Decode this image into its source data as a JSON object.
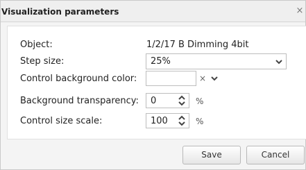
{
  "dialog": {
    "title": "Visualization parameters",
    "close_glyph": "×"
  },
  "fields": {
    "object": {
      "label": "Object:",
      "value": "1/2/17 B Dimming 4bit"
    },
    "step_size": {
      "label": "Step size:",
      "selected": "25%"
    },
    "background_color": {
      "label": "Control background color:",
      "value": "",
      "clear_glyph": "×"
    },
    "background_transparency": {
      "label": "Background transparency:",
      "value": "0",
      "unit": "%"
    },
    "control_size_scale": {
      "label": "Control size scale:",
      "value": "100",
      "unit": "%"
    }
  },
  "buttons": {
    "save": "Save",
    "cancel": "Cancel"
  },
  "icons": {
    "close": "close-icon",
    "dropdown": "chevron-down-icon",
    "spin_up": "chevron-up-icon",
    "spin_down": "chevron-down-icon",
    "clear": "clear-icon"
  },
  "colors": {
    "dialog_background": "#f4f4f4",
    "panel_background": "#ffffff",
    "input_border": "#bdbdbd",
    "text": "#222222"
  }
}
